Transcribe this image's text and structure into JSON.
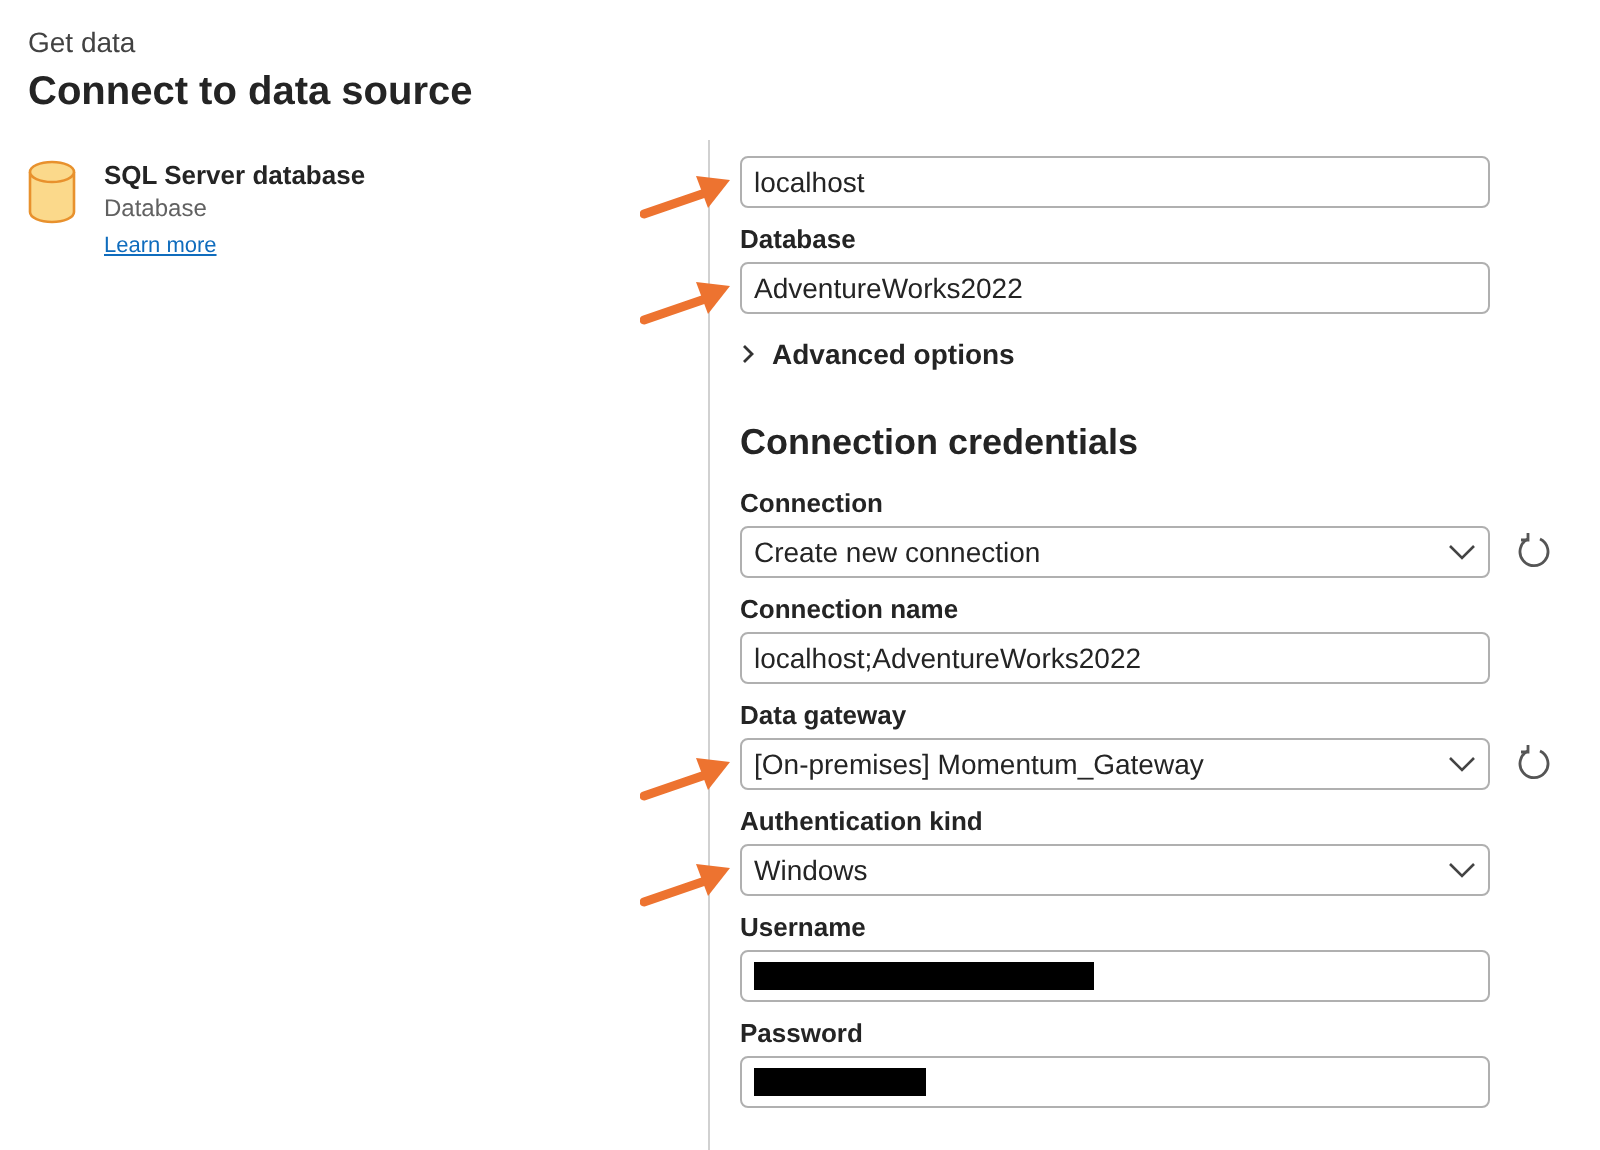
{
  "header": {
    "breadcrumb": "Get data",
    "title": "Connect to data source"
  },
  "connector": {
    "name": "SQL Server database",
    "category": "Database",
    "link": "Learn more"
  },
  "connection_settings": {
    "fields": [
      {
        "kind": "text",
        "value": "localhost",
        "annotated": true
      },
      {
        "kind": "text",
        "label": "Database",
        "value": "AdventureWorks2022",
        "annotated": true
      }
    ],
    "advanced_options": {
      "label": "Advanced options",
      "expanded": false
    }
  },
  "credentials": {
    "heading": "Connection credentials",
    "fields": [
      {
        "kind": "select",
        "label": "Connection",
        "value": "Create new connection",
        "refresh": true
      },
      {
        "kind": "text",
        "label": "Connection name",
        "value": "localhost;AdventureWorks2022"
      },
      {
        "kind": "select",
        "label": "Data gateway",
        "value": "[On-premises] Momentum_Gateway",
        "annotated": true,
        "refresh": true
      },
      {
        "kind": "select",
        "label": "Authentication kind",
        "value": "Windows",
        "annotated": true
      },
      {
        "kind": "redacted",
        "label": "Username"
      },
      {
        "kind": "redacted",
        "label": "Password"
      }
    ]
  }
}
